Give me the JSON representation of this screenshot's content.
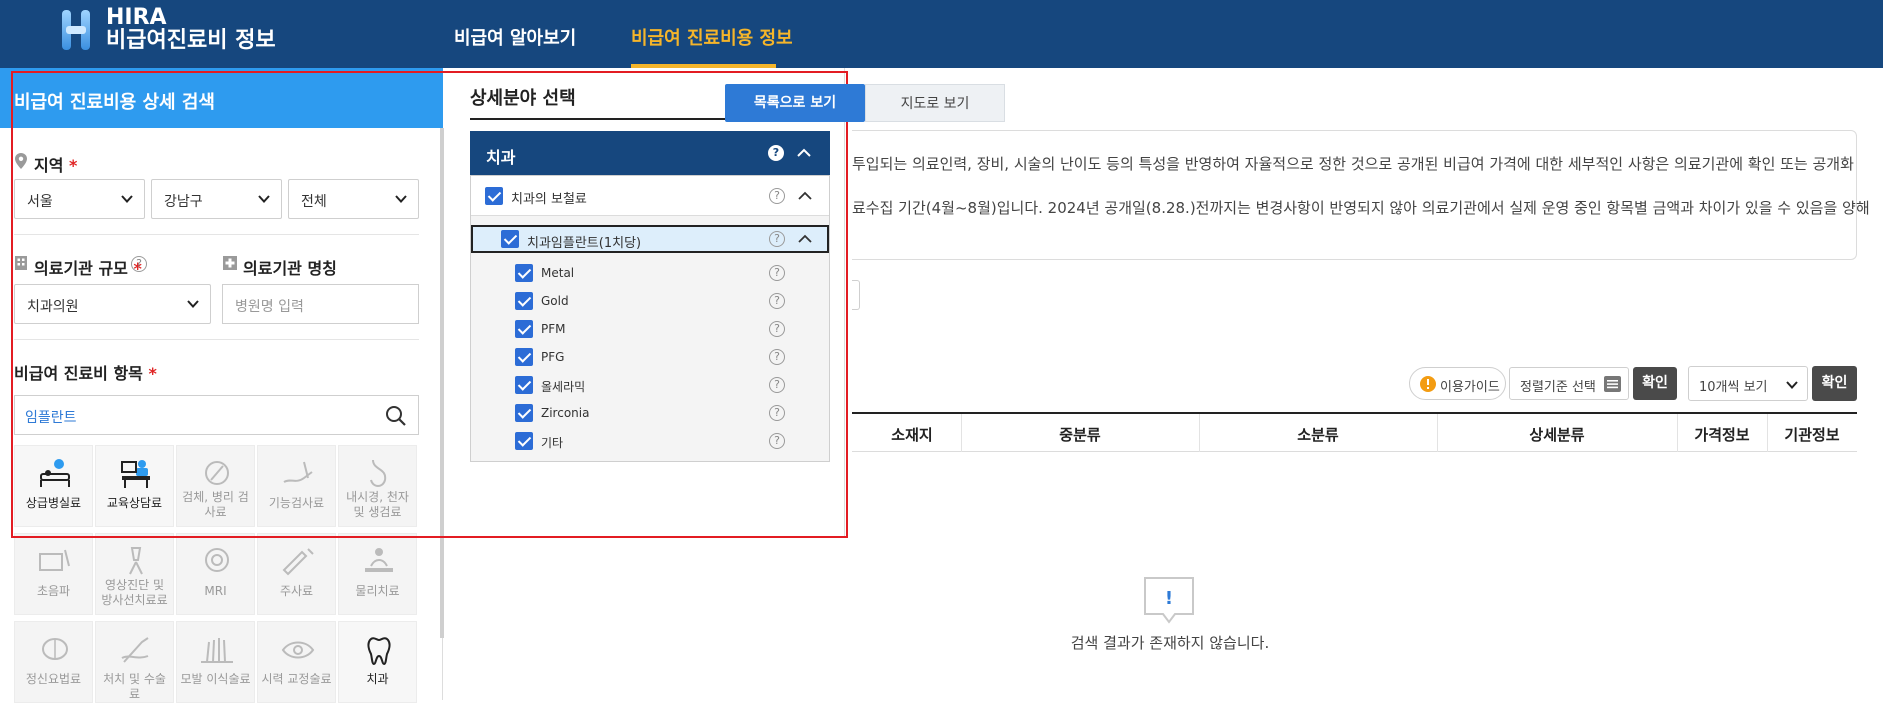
{
  "header": {
    "logo_title": "HIRA",
    "logo_subtitle": "비급여진료비 정보",
    "nav": [
      {
        "label": "비급여 알아보기",
        "active": false
      },
      {
        "label": "비급여 진료비용 정보",
        "active": true
      }
    ],
    "colors": {
      "bg": "#16477e",
      "active": "#f5b52a"
    }
  },
  "search_panel": {
    "title": "비급여 진료비용 상세 검색",
    "region": {
      "label": "지역",
      "required_mark": "*",
      "selects": [
        "서울",
        "강남구",
        "전체"
      ]
    },
    "scale": {
      "label": "의료기관 규모",
      "required_mark": "*",
      "value": "치과의원",
      "help_icon": "question-circle-icon"
    },
    "name": {
      "label": "의료기관 명칭",
      "placeholder": "병원명 입력"
    },
    "item": {
      "label": "비급여 진료비 항목",
      "required_mark": "*",
      "value": "임플란트"
    },
    "tiles": [
      {
        "label": "상급병실료",
        "icon": "hospital-bed-icon",
        "enabled": true
      },
      {
        "label": "교육상담료",
        "icon": "counseling-icon",
        "enabled": true
      },
      {
        "label": "검체, 병리 검사료",
        "icon": "specimen-icon",
        "enabled": false
      },
      {
        "label": "기능검사료",
        "icon": "function-test-icon",
        "enabled": false
      },
      {
        "label": "내시경, 천자 및 생검료",
        "icon": "endoscope-icon",
        "enabled": false
      },
      {
        "label": "초음파",
        "icon": "ultrasound-icon",
        "enabled": false
      },
      {
        "label": "영상진단 및 방사선치료료",
        "icon": "radiology-icon",
        "enabled": false
      },
      {
        "label": "MRI",
        "icon": "mri-icon",
        "enabled": false
      },
      {
        "label": "주사료",
        "icon": "syringe-icon",
        "enabled": false
      },
      {
        "label": "물리치료",
        "icon": "physical-therapy-icon",
        "enabled": false
      },
      {
        "label": "정신요법료",
        "icon": "brain-icon",
        "enabled": false
      },
      {
        "label": "처치 및 수술료",
        "icon": "surgery-icon",
        "enabled": false
      },
      {
        "label": "모발 이식술료",
        "icon": "hair-icon",
        "enabled": false
      },
      {
        "label": "시력 교정술료",
        "icon": "eye-icon",
        "enabled": false
      },
      {
        "label": "치과",
        "icon": "tooth-icon",
        "enabled": true
      }
    ]
  },
  "detail_modal": {
    "title": "상세분야 선택",
    "category": "치과",
    "level1": {
      "label": "치과의 보철료",
      "checked": true
    },
    "level2": {
      "label": "치과임플란트(1치당)",
      "checked": true
    },
    "items": [
      {
        "label": "Metal",
        "checked": true
      },
      {
        "label": "Gold",
        "checked": true
      },
      {
        "label": "PFM",
        "checked": true
      },
      {
        "label": "PFG",
        "checked": true
      },
      {
        "label": "올세라믹",
        "checked": true
      },
      {
        "label": "Zirconia",
        "checked": true
      },
      {
        "label": "기타",
        "checked": true
      }
    ],
    "colors": {
      "header": "#16477e",
      "check": "#2c6cd6",
      "highlight": "#ff0000"
    }
  },
  "results": {
    "view_list_label": "목록으로 보기",
    "view_map_label": "지도로 보기",
    "notice_line1": "투입되는 의료인력, 장비, 시술의 난이도 등의 특성을 반영하여 자율적으로 정한 것으로 공개된 비급여 가격에 대한 세부적인 사항은 의료기관에 확인 또는 공개화",
    "notice_line2": "료수집 기간(4월~8월)입니다. 2024년 공개일(8.28.)전까지는 변경사항이 반영되지 않아 의료기관에서 실제 운영 중인 항목별 금액과 차이가 있을 수 있음을 양해",
    "guide_label": "이용가이드",
    "sort_label": "정렬기준 선택",
    "confirm_label": "확인",
    "page_size_value": "10개씩 보기",
    "confirm2_label": "확인",
    "columns": [
      "소재지",
      "중분류",
      "소분류",
      "상세분류",
      "가격정보",
      "기관정보"
    ],
    "empty_icon": "!",
    "empty_text": "검색 결과가 존재하지 않습니다."
  }
}
